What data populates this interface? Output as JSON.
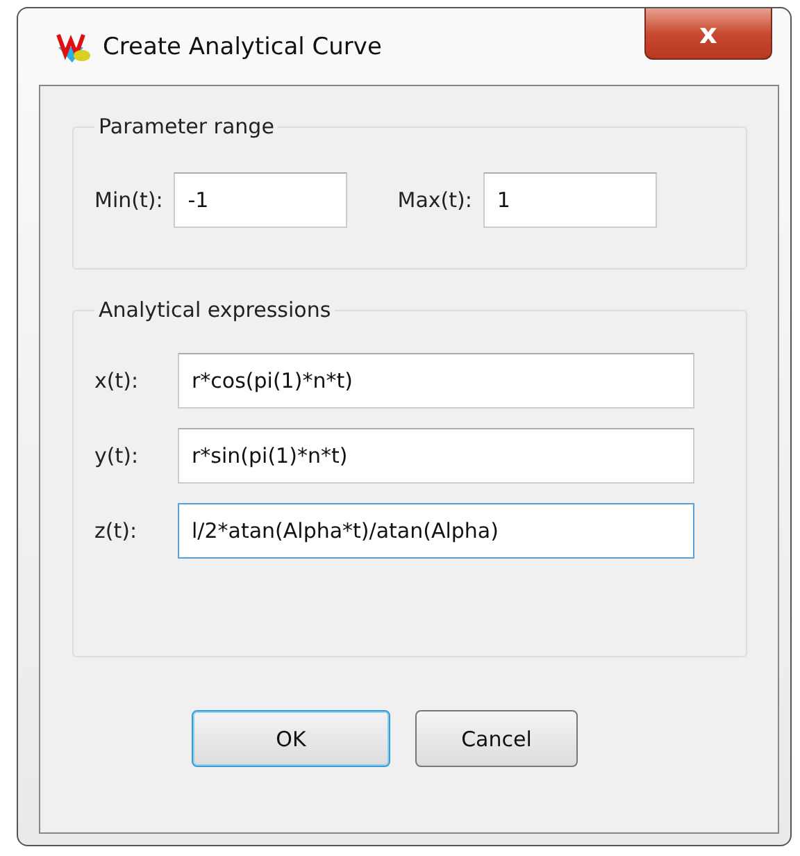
{
  "window": {
    "title": "Create Analytical Curve",
    "close": "x"
  },
  "parameter_range": {
    "title": "Parameter range",
    "fields": [
      {
        "label": "Min(t):",
        "value": "-1",
        "focused": false
      },
      {
        "label": "Max(t):",
        "value": "1",
        "focused": false
      }
    ]
  },
  "analytical_expressions": {
    "title": "Analytical expressions",
    "fields": [
      {
        "label": "x(t):",
        "value": "r*cos(pi(1)*n*t)",
        "focused": false
      },
      {
        "label": "y(t):",
        "value": "r*sin(pi(1)*n*t)",
        "focused": false
      },
      {
        "label": "z(t):",
        "value": "l/2*atan(Alpha*t)/atan(Alpha)",
        "focused": true
      }
    ]
  },
  "buttons": [
    {
      "label": "OK",
      "default": true
    },
    {
      "label": "Cancel",
      "default": false
    }
  ]
}
